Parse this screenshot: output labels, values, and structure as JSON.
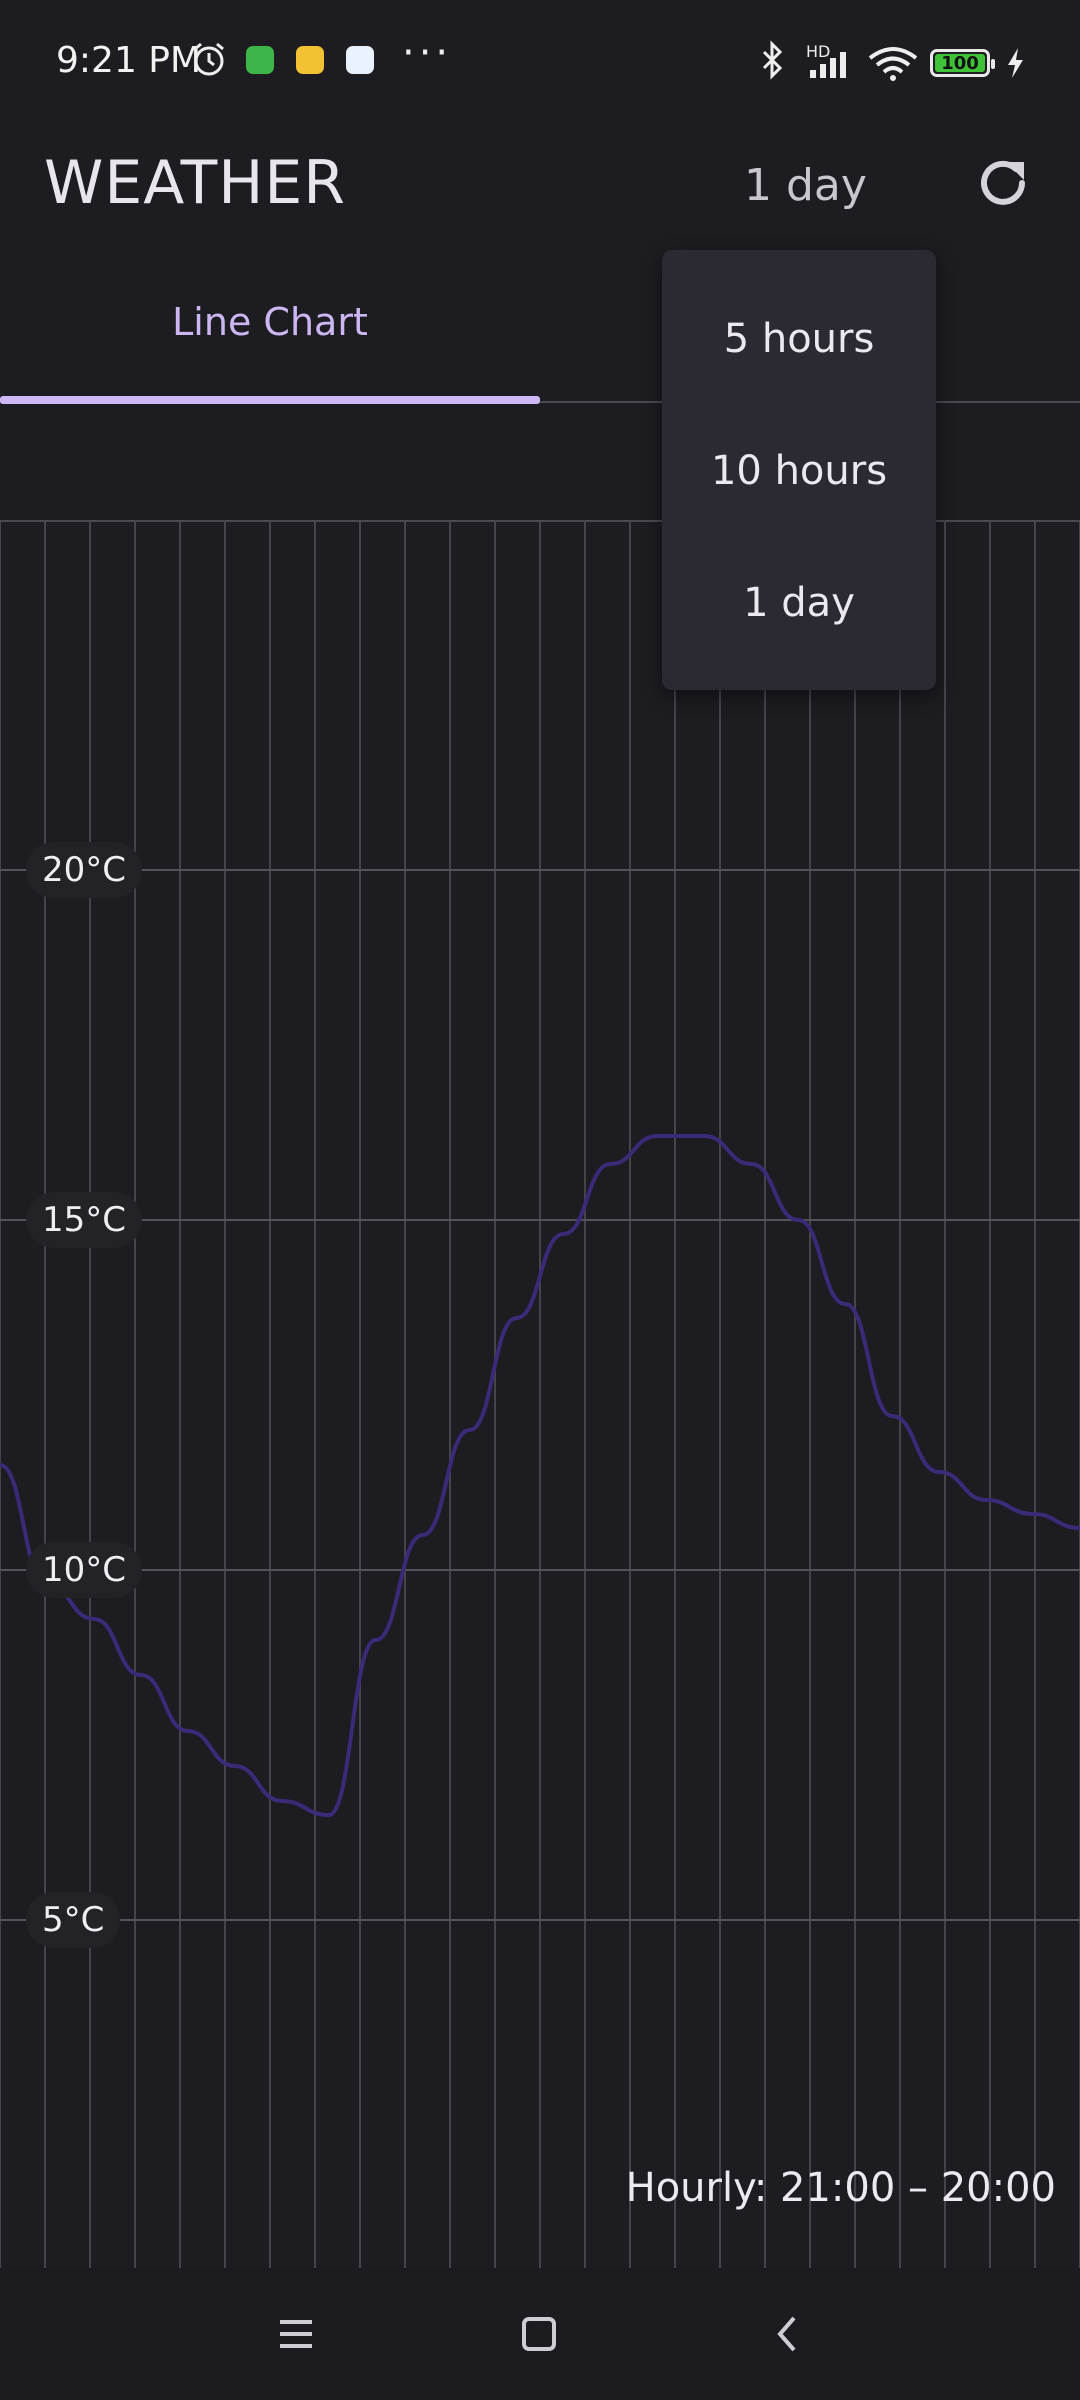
{
  "status_bar": {
    "time": "9:21 PM",
    "battery": "100",
    "network": "HD",
    "icons": [
      "alarm-icon",
      "app-notification-icon",
      "app-notification-icon",
      "app-notification-icon",
      "more-icon",
      "bluetooth-icon",
      "signal-icon",
      "wifi-icon",
      "battery-icon",
      "charging-icon"
    ]
  },
  "app_bar": {
    "title": "WEATHER",
    "range_selected": "1 day",
    "refresh_icon": "refresh-icon"
  },
  "tabs": [
    {
      "label": "Line Chart",
      "active": true
    }
  ],
  "dropdown": {
    "options": [
      "5 hours",
      "10 hours",
      "1 day"
    ]
  },
  "chart_data": {
    "type": "line",
    "caption": "Hourly: 21:00 – 20:00",
    "y_tick_labels": [
      "20°C",
      "15°C",
      "10°C",
      "5°C"
    ],
    "y_ticks": [
      20,
      15,
      10,
      5
    ],
    "ylim": [
      0,
      25
    ],
    "grid": true,
    "line_color": "#3b2a78",
    "series": [
      {
        "x": [
          "21:00",
          "22:00",
          "23:00",
          "00:00",
          "01:00",
          "02:00",
          "03:00",
          "04:00",
          "05:00",
          "06:00",
          "07:00",
          "08:00",
          "09:00",
          "10:00",
          "11:00",
          "12:00",
          "13:00",
          "14:00",
          "15:00",
          "16:00",
          "17:00",
          "18:00",
          "19:00",
          "20:00"
        ],
        "values": [
          11.5,
          9.8,
          9.3,
          8.5,
          7.7,
          7.2,
          6.7,
          6.5,
          9.0,
          10.5,
          12.0,
          13.6,
          14.8,
          15.8,
          16.2,
          16.2,
          15.8,
          15.0,
          13.8,
          12.2,
          11.4,
          11.0,
          10.8,
          10.6
        ]
      }
    ]
  },
  "nav_bar": {
    "icons": [
      "menu-icon",
      "home-icon",
      "back-icon"
    ]
  }
}
